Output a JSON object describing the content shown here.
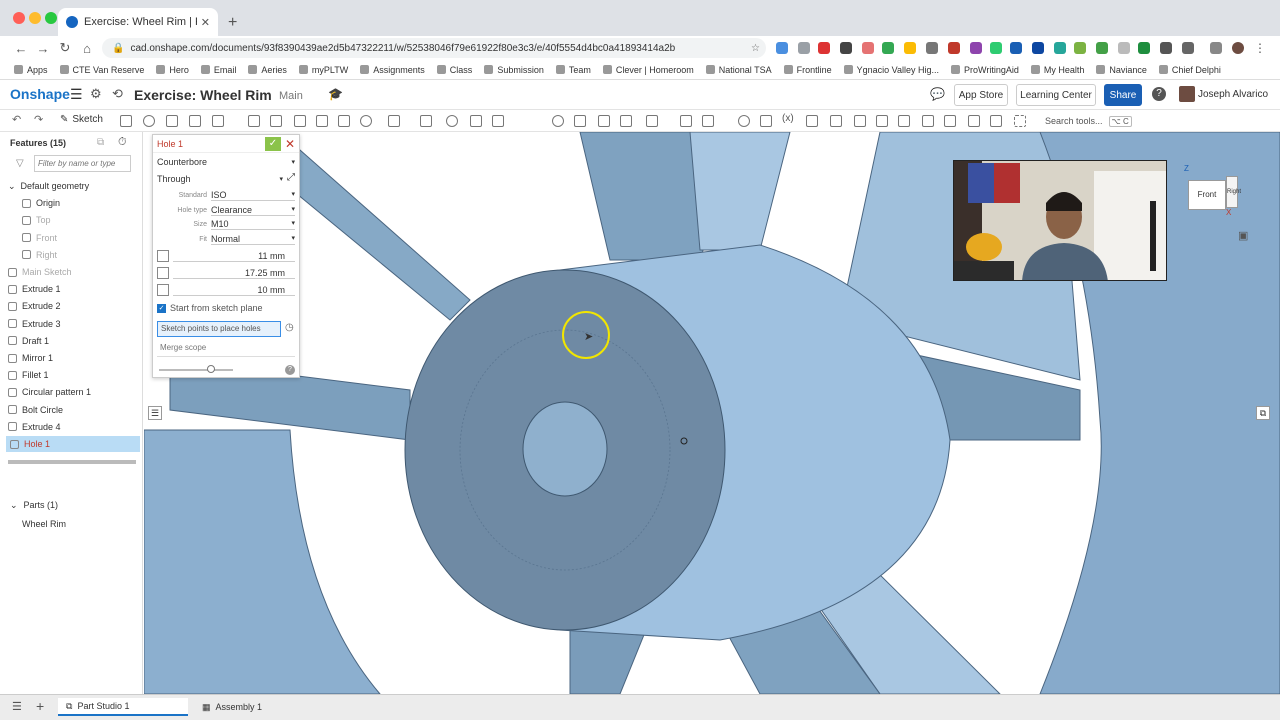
{
  "browser": {
    "tab_title": "Exercise: Wheel Rim | Part Stu",
    "url": "cad.onshape.com/documents/93f8390439ae2d5b47322211/w/52538046f79e61922f80e3c3/e/40f5554d4bc0a41893414a2b",
    "bookmarks": [
      "Apps",
      "CTE Van Reserve",
      "Hero",
      "Email",
      "Aeries",
      "myPLTW",
      "Assignments",
      "Class",
      "Submission",
      "Team",
      "Clever | Homeroom",
      "National TSA",
      "Frontline",
      "Ygnacio Valley Hig...",
      "ProWritingAid",
      "My Health",
      "Naviance",
      "Chief Delphi"
    ]
  },
  "app": {
    "logo": "Onshape",
    "doc_title": "Exercise: Wheel Rim",
    "branch": "Main",
    "app_store": "App Store",
    "learning_center": "Learning Center",
    "share": "Share",
    "help": "?",
    "user": "Joseph Alvarico"
  },
  "toolbar": {
    "sketch": "Sketch",
    "search_tools": "Search tools...",
    "search_shortcut": "⌥ C"
  },
  "features": {
    "header": "Features (15)",
    "filter_placeholder": "Filter by name or type",
    "items": [
      {
        "label": "Default geometry"
      },
      {
        "label": "Origin"
      },
      {
        "label": "Top"
      },
      {
        "label": "Front"
      },
      {
        "label": "Right"
      },
      {
        "label": "Main Sketch"
      },
      {
        "label": "Extrude 1"
      },
      {
        "label": "Extrude 2"
      },
      {
        "label": "Extrude 3"
      },
      {
        "label": "Draft 1"
      },
      {
        "label": "Mirror 1"
      },
      {
        "label": "Fillet 1"
      },
      {
        "label": "Circular pattern 1"
      },
      {
        "label": "Bolt Circle"
      },
      {
        "label": "Extrude 4"
      },
      {
        "label": "Hole 1"
      }
    ],
    "parts_header": "Parts (1)",
    "parts": [
      "Wheel Rim"
    ]
  },
  "hole_dialog": {
    "title": "Hole 1",
    "style": "Counterbore",
    "termination": "Through",
    "standard_label": "Standard",
    "standard": "ISO",
    "hole_type_label": "Hole type",
    "hole_type": "Clearance",
    "size_label": "Size",
    "size": "M10",
    "fit_label": "Fit",
    "fit": "Normal",
    "diameter": "11 mm",
    "cbore_diameter": "17.25 mm",
    "cbore_depth": "10 mm",
    "start_from_sketch": "Start from sketch plane",
    "sketch_points": "Sketch points to place holes",
    "merge_scope": "Merge scope",
    "slider_value": 0.7
  },
  "viewcube": {
    "face": "Front",
    "side": "Right",
    "axis_z": "Z",
    "axis_x": "X"
  },
  "bottom_tabs": [
    "Part Studio 1",
    "Assembly 1"
  ],
  "colors": {
    "part_blue": "#8fb5d8",
    "accent": "#1a73c7",
    "selected": "#b9dcf5"
  }
}
